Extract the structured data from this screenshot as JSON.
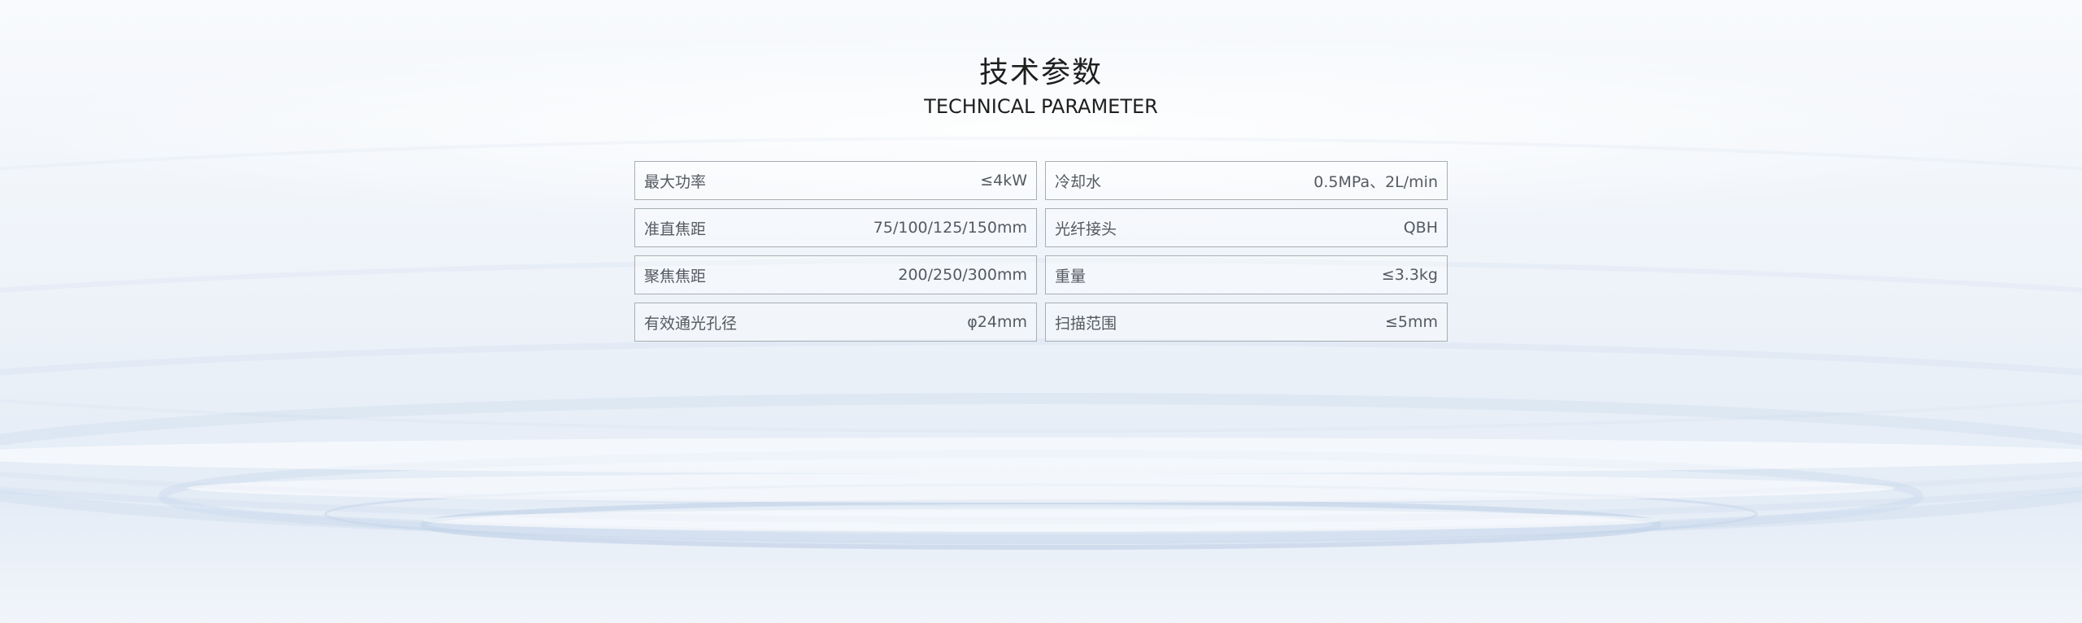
{
  "header": {
    "title": "技术参数",
    "subtitle": "TECHNICAL PARAMETER"
  },
  "params": [
    {
      "name": "最大功率",
      "value": "≤4kW"
    },
    {
      "name": "冷却水",
      "value": "0.5MPa、2L/min"
    },
    {
      "name": "准直焦距",
      "value": "75/100/125/150mm"
    },
    {
      "name": "光纤接头",
      "value": "QBH"
    },
    {
      "name": "聚焦焦距",
      "value": "200/250/300mm"
    },
    {
      "name": "重量",
      "value": "≤3.3kg"
    },
    {
      "name": "有效通光孔径",
      "value": "φ24mm"
    },
    {
      "name": "扫描范围",
      "value": "≤5mm"
    }
  ],
  "colors": {
    "background": "#f4f7fb",
    "text_dark": "#1e1e1e",
    "text_muted": "#555a60",
    "border": "#a9aeb4",
    "ripple": "#c7d6ea"
  }
}
